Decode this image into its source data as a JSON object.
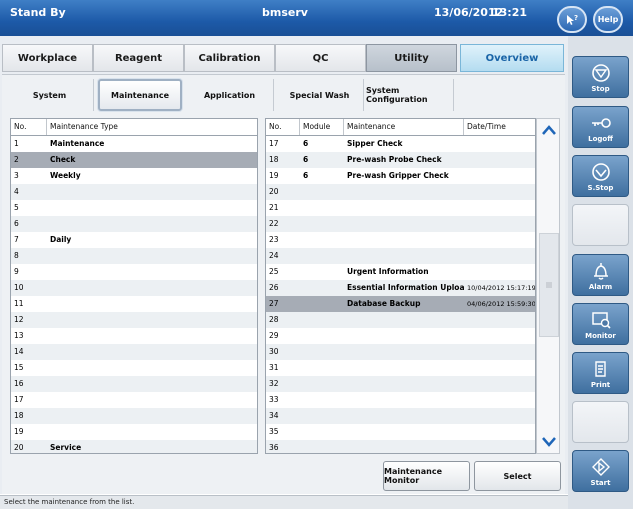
{
  "header": {
    "status": "Stand By",
    "user": "bmserv",
    "date": "13/06/2012",
    "time": "13:21",
    "help_label": "Help"
  },
  "main_tabs": [
    "Workplace",
    "Reagent",
    "Calibration",
    "QC",
    "Utility",
    "Overview"
  ],
  "sub_tabs": [
    "System",
    "Maintenance",
    "Application",
    "Special Wash",
    "System Configuration"
  ],
  "left_table": {
    "headers": [
      "No.",
      "Maintenance Type"
    ],
    "rows": [
      [
        "1",
        "Maintenance"
      ],
      [
        "2",
        "Check"
      ],
      [
        "3",
        "Weekly"
      ],
      [
        "4",
        ""
      ],
      [
        "5",
        ""
      ],
      [
        "6",
        ""
      ],
      [
        "7",
        "Daily"
      ],
      [
        "8",
        ""
      ],
      [
        "9",
        ""
      ],
      [
        "10",
        ""
      ],
      [
        "11",
        ""
      ],
      [
        "12",
        ""
      ],
      [
        "13",
        ""
      ],
      [
        "14",
        ""
      ],
      [
        "15",
        ""
      ],
      [
        "16",
        ""
      ],
      [
        "17",
        ""
      ],
      [
        "18",
        ""
      ],
      [
        "19",
        ""
      ],
      [
        "20",
        "Service"
      ]
    ],
    "selected_index": 1
  },
  "right_table": {
    "headers": [
      "No.",
      "Module",
      "Maintenance",
      "Date/Time"
    ],
    "rows": [
      [
        "17",
        "6",
        "Sipper Check",
        ""
      ],
      [
        "18",
        "6",
        "Pre-wash Probe Check",
        ""
      ],
      [
        "19",
        "6",
        "Pre-wash Gripper Check",
        ""
      ],
      [
        "20",
        "",
        "",
        ""
      ],
      [
        "21",
        "",
        "",
        ""
      ],
      [
        "22",
        "",
        "",
        ""
      ],
      [
        "23",
        "",
        "",
        ""
      ],
      [
        "24",
        "",
        "",
        ""
      ],
      [
        "25",
        "",
        "Urgent Information",
        ""
      ],
      [
        "26",
        "",
        "Essential Information Upload",
        "10/04/2012 15:17:19"
      ],
      [
        "27",
        "",
        "Database Backup",
        "04/06/2012 15:59:30"
      ],
      [
        "28",
        "",
        "",
        ""
      ],
      [
        "29",
        "",
        "",
        ""
      ],
      [
        "30",
        "",
        "",
        ""
      ],
      [
        "31",
        "",
        "",
        ""
      ],
      [
        "32",
        "",
        "",
        ""
      ],
      [
        "33",
        "",
        "",
        ""
      ],
      [
        "34",
        "",
        "",
        ""
      ],
      [
        "35",
        "",
        "",
        ""
      ],
      [
        "36",
        "",
        "",
        ""
      ]
    ],
    "selected_index": 10
  },
  "buttons": {
    "maintenance_monitor": "Maintenance Monitor",
    "select": "Select"
  },
  "status_bar": "Select the maintenance from the list.",
  "sidebar": [
    {
      "label": "Stop",
      "icon": "stop-icon"
    },
    {
      "label": "Logoff",
      "icon": "key-icon"
    },
    {
      "label": "S.Stop",
      "icon": "sampling-stop-icon"
    },
    {
      "label": "",
      "icon": ""
    },
    {
      "label": "Alarm",
      "icon": "bell-icon"
    },
    {
      "label": "Monitor",
      "icon": "monitor-icon"
    },
    {
      "label": "Print",
      "icon": "printer-icon"
    },
    {
      "label": "",
      "icon": ""
    },
    {
      "label": "Start",
      "icon": "start-icon"
    }
  ],
  "colors": {
    "header_blue": "#1d5aa8",
    "selected_row": "#a6acb5",
    "overview_text": "#1a64a7"
  }
}
